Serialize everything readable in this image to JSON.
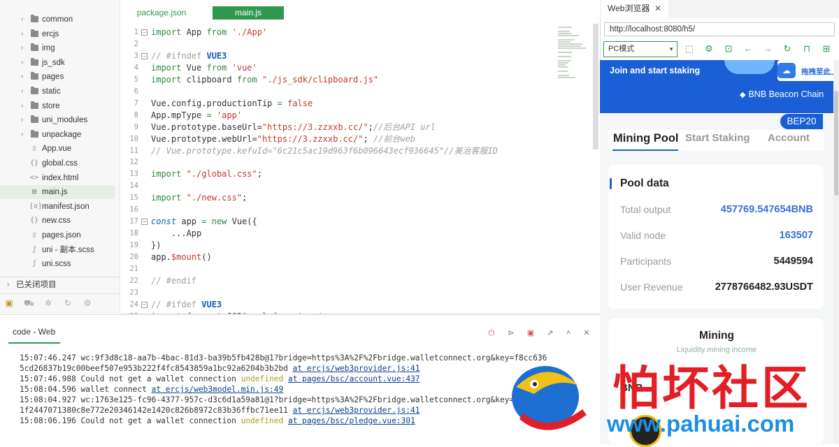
{
  "explorer": {
    "items": [
      {
        "label": "common",
        "type": "folder"
      },
      {
        "label": "ercjs",
        "type": "folder"
      },
      {
        "label": "img",
        "type": "folder"
      },
      {
        "label": "js_sdk",
        "type": "folder"
      },
      {
        "label": "pages",
        "type": "folder"
      },
      {
        "label": "static",
        "type": "folder"
      },
      {
        "label": "store",
        "type": "folder"
      },
      {
        "label": "uni_modules",
        "type": "folder"
      },
      {
        "label": "unpackage",
        "type": "folder"
      },
      {
        "label": "App.vue",
        "type": "file",
        "glyph": "▯"
      },
      {
        "label": "global.css",
        "type": "file",
        "glyph": "{}"
      },
      {
        "label": "index.html",
        "type": "file",
        "glyph": "<>"
      },
      {
        "label": "main.js",
        "type": "file",
        "glyph": "▤",
        "selected": true
      },
      {
        "label": "manifest.json",
        "type": "file",
        "glyph": "[o]"
      },
      {
        "label": "new.css",
        "type": "file",
        "glyph": "{}"
      },
      {
        "label": "pages.json",
        "type": "file",
        "glyph": "▯"
      },
      {
        "label": "uni - 副本.scss",
        "type": "file",
        "glyph": "ʃ"
      },
      {
        "label": "uni.scss",
        "type": "file",
        "glyph": "ʃ"
      }
    ],
    "closed_projects": "已关闭项目"
  },
  "editor_tabs": [
    {
      "label": "package.json"
    },
    {
      "label": "main.js",
      "active": true
    }
  ],
  "code_lines": [
    {
      "n": "1",
      "fold": true,
      "html": "<span class='kw'>import</span> App <span class='kw'>from</span> <span class='str'>'./App'</span>"
    },
    {
      "n": "2",
      "html": ""
    },
    {
      "n": "3",
      "fold": true,
      "html": "<span class='cm' style='font-style:normal'>// #ifndef </span><span class='kb'>VUE3</span>"
    },
    {
      "n": "4",
      "html": "<span class='kw'>import</span> Vue <span class='kw'>from</span> <span class='str'>'vue'</span>"
    },
    {
      "n": "5",
      "html": "<span class='kw'>import</span> clipboard <span class='kw'>from</span> <span class='str'>\"./js_sdk/clipboard.js\"</span>"
    },
    {
      "n": "6",
      "html": ""
    },
    {
      "n": "7",
      "html": "Vue.config.productionTip <span class='kw'>=</span> <span class='str'>false</span>"
    },
    {
      "n": "8",
      "html": "App.mpType <span class='kw'>=</span> <span class='str'>'app'</span>"
    },
    {
      "n": "9",
      "html": "Vue.prototype.baseUrl=<span class='str'>\"https://3.zzxxb.cc/\"</span>;<span class='cm'>//后台API url</span>"
    },
    {
      "n": "10",
      "html": "Vue.prototype.webUrl=<span class='str'>\"https://3.zzxxb.cc/\"</span>; <span class='cm'>//前台web</span>"
    },
    {
      "n": "11",
      "html": "<span class='cm'>// Vue.prototype.kefuId=\"6c21c5ac19d963f6b096643ecf936645\"//美治客服ID</span>"
    },
    {
      "n": "12",
      "html": ""
    },
    {
      "n": "13",
      "html": "<span class='kw'>import</span> <span class='str'>\"./global.css\"</span>;"
    },
    {
      "n": "14",
      "html": ""
    },
    {
      "n": "15",
      "html": "<span class='kw'>import</span> <span class='str'>\"./new.css\"</span>;"
    },
    {
      "n": "16",
      "html": ""
    },
    {
      "n": "17",
      "fold": true,
      "html": "<span class='kbl'>const</span> app <span class='kw'>=</span> <span class='kw'>new</span> Vue({"
    },
    {
      "n": "18",
      "html": "    ...App"
    },
    {
      "n": "19",
      "html": "})"
    },
    {
      "n": "20",
      "html": "app.<span class='str'>$mount</span>()"
    },
    {
      "n": "21",
      "html": ""
    },
    {
      "n": "22",
      "html": "<span class='cm' style='font-style:normal'>// #endif</span>"
    },
    {
      "n": "23",
      "html": ""
    },
    {
      "n": "24",
      "fold": true,
      "html": "<span class='cm' style='font-style:normal'>// #ifdef </span><span class='kb'>VUE3</span>"
    },
    {
      "n": "25",
      "html": "<span class='kw'>import</span> { createSSRApp } <span class='kw'>from</span> <span class='str'>'vue'</span>"
    }
  ],
  "console": {
    "tab": "code - Web",
    "lines": [
      {
        "html": "15:07:46.247 wc:9f3d8c18-aa7b-4bac-81d3-ba39b5fb428b@1?bridge=https%3A%2F%2Fbridge.walletconnect.org&key=f8cc636"
      },
      {
        "html": "5cd26837b19c00beef507e953b222f4fc8543859a1bc92a6204b3b2bd <span class='lnk'>at ercjs/web3provider.js:41</span>"
      },
      {
        "html": "15:07:46.988 Could not get a wallet connection <span class='und'>undefined</span> <span class='lnk'>at pages/bsc/account.vue:437</span>"
      },
      {
        "html": "15:08:04.596 wallet connect <span class='lnk'>at ercjs/web3model.min.js:49</span>"
      },
      {
        "html": "15:08:04.927 wc:1763e125-fc96-4377-957c-d3c6d1a59a81@1?bridge=https%3A%2F%2Fbridge.walletconnect.org&key=b"
      },
      {
        "html": "1f2447071380c8e772e20346142e1420c826b8972c83b36ffbc71ee11 <span class='lnk'>at ercjs/web3provider.js:41</span>"
      },
      {
        "html": "15:08:06.196 Could not get a wallet connection <span class='und'>undefined</span> <span class='lnk'>at pages/bsc/pledge.vue:301</span>"
      }
    ]
  },
  "browser": {
    "tab_title": "Web浏览器",
    "close": "✕",
    "url": "http://localhost:8080/h5/",
    "mode": "PC模式",
    "hero_text": "Join and start staking",
    "chain": "BNB Beacon Chain",
    "drag_text": "拖拽至此上传",
    "badge": "BEP20",
    "tabs": [
      "Mining Pool",
      "Start Staking",
      "Account"
    ],
    "pool_title": "Pool data",
    "rows": [
      {
        "k": "Total output",
        "v": "457769.547654BNB",
        "blue": true
      },
      {
        "k": "Valid node",
        "v": "163507",
        "blue": true
      },
      {
        "k": "Participants",
        "v": "5449594",
        "blue": false
      },
      {
        "k": "User Revenue",
        "v": "2778766482.93USDT",
        "blue": false
      }
    ],
    "mining_title": "Mining",
    "mining_sub": "Liquidity mining income",
    "bnb_label": "BNB"
  },
  "watermark": {
    "text": "怕坏社区",
    "url": "www.pahuai.com"
  },
  "colors": {
    "accent": "#2f9a4e",
    "brand_blue": "#1b5fd6",
    "watermark_red": "#e31e24",
    "watermark_blue": "#1d8fe0"
  }
}
